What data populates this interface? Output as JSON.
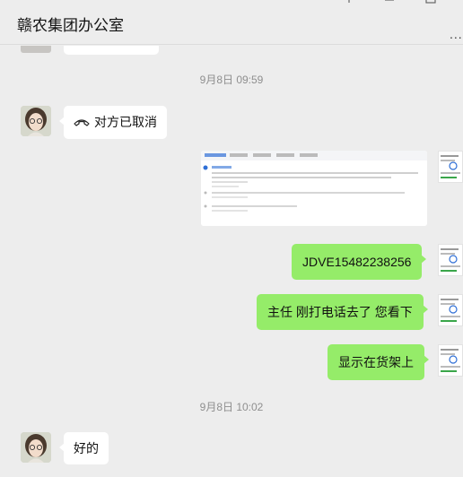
{
  "window": {
    "title": "赣农集团办公室",
    "more_label": "..."
  },
  "messages": [
    {
      "type": "time",
      "text": "9月8日 09:59"
    },
    {
      "type": "in",
      "text": "对方已取消",
      "icon": "phone-hangup-icon"
    },
    {
      "type": "out-image",
      "description": "screenshot"
    },
    {
      "type": "out",
      "text": "JDVE15482238256"
    },
    {
      "type": "out",
      "text": "主任 刚打电话去了 您看下"
    },
    {
      "type": "out",
      "text": "显示在货架上"
    },
    {
      "type": "time",
      "text": "9月8日 10:02"
    },
    {
      "type": "in",
      "text": "好的"
    }
  ],
  "colors": {
    "background": "#ededed",
    "outgoing_bubble": "#95ec69",
    "incoming_bubble": "#ffffff",
    "timestamp": "#8f8f8f"
  }
}
